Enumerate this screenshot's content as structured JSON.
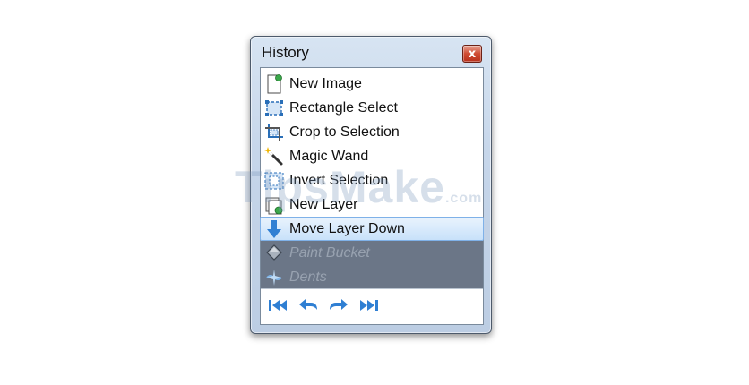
{
  "window": {
    "title": "History",
    "close_glyph": "x"
  },
  "history": {
    "items": [
      {
        "label": "New Image",
        "icon": "new-image-icon",
        "state": "normal"
      },
      {
        "label": "Rectangle Select",
        "icon": "rectangle-select-icon",
        "state": "normal"
      },
      {
        "label": "Crop to Selection",
        "icon": "crop-icon",
        "state": "normal"
      },
      {
        "label": "Magic Wand",
        "icon": "magic-wand-icon",
        "state": "normal"
      },
      {
        "label": "Invert Selection",
        "icon": "invert-selection-icon",
        "state": "normal"
      },
      {
        "label": "New Layer",
        "icon": "new-layer-icon",
        "state": "normal"
      },
      {
        "label": "Move Layer Down",
        "icon": "arrow-down-icon",
        "state": "selected"
      },
      {
        "label": "Paint Bucket",
        "icon": "paint-bucket-icon",
        "state": "undone"
      },
      {
        "label": "Dents",
        "icon": "dents-icon",
        "state": "undone"
      }
    ]
  },
  "toolbar": {
    "buttons": [
      {
        "icon": "rewind-to-start-icon"
      },
      {
        "icon": "undo-icon"
      },
      {
        "icon": "redo-icon"
      },
      {
        "icon": "fast-forward-to-end-icon"
      }
    ]
  },
  "watermark": {
    "text": "TipsMake",
    "domain": ".com"
  },
  "colors": {
    "selected_row": "#c8e1fa",
    "undone_row": "#6b7687",
    "close_button": "#cf4b32",
    "toolbar_icon": "#2f7fd3"
  }
}
